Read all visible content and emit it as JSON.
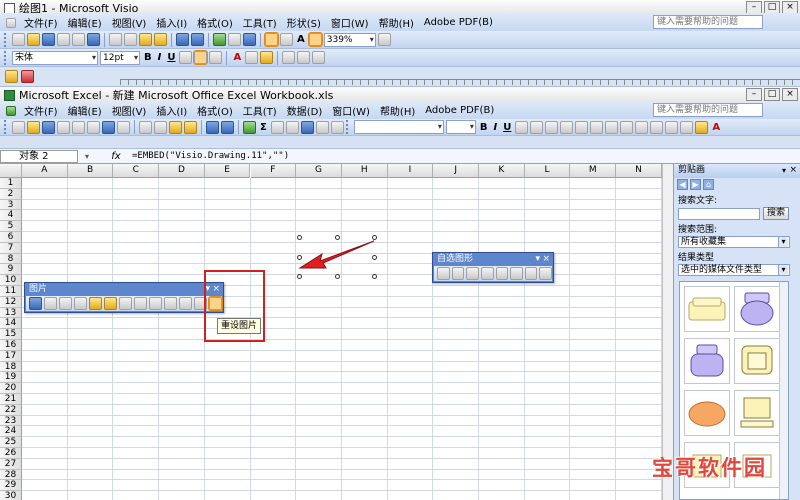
{
  "visio": {
    "title": "绘图1 - Microsoft Visio",
    "menu": [
      "文件(F)",
      "编辑(E)",
      "视图(V)",
      "插入(I)",
      "格式(O)",
      "工具(T)",
      "形状(S)",
      "窗口(W)",
      "帮助(H)",
      "Adobe PDF(B)"
    ],
    "help_placeholder": "键入需要帮助的问题",
    "zoom": "339%",
    "font_name": "宋体",
    "font_size": "12pt"
  },
  "excel": {
    "title": "Microsoft Excel - 新建 Microsoft Office Excel Workbook.xls",
    "menu": [
      "文件(F)",
      "编辑(E)",
      "视图(V)",
      "插入(I)",
      "格式(O)",
      "工具(T)",
      "数据(D)",
      "窗口(W)",
      "帮助(H)",
      "Adobe PDF(B)"
    ],
    "help_placeholder": "键入需要帮助的问题",
    "name_box": "对象 2",
    "fx": "fx",
    "formula": "=EMBED(\"Visio.Drawing.11\",\"\")",
    "columns": [
      "A",
      "B",
      "C",
      "D",
      "E",
      "F",
      "G",
      "H",
      "I",
      "J",
      "K",
      "L",
      "M",
      "N"
    ],
    "rows": [
      "1",
      "2",
      "3",
      "4",
      "5",
      "6",
      "7",
      "8",
      "9",
      "10",
      "11",
      "12",
      "13",
      "14",
      "15",
      "16",
      "17",
      "18",
      "19",
      "20",
      "21",
      "22",
      "23",
      "24",
      "25",
      "26",
      "27",
      "28",
      "29",
      "30"
    ]
  },
  "picture_toolbar": {
    "title": "图片",
    "tooltip": "重设图片"
  },
  "autoshape_toolbar": {
    "title": "自选图形"
  },
  "clipart_pane": {
    "title": "剪贴画",
    "search_label": "搜索文字:",
    "search_button": "搜索",
    "scope_label": "搜索范围:",
    "scope_value": "所有收藏集",
    "types_label": "结果类型",
    "types_value": "选中的媒体文件类型"
  },
  "watermark": "宝哥软件园",
  "colors": {
    "accent_blue": "#5d86cc",
    "highlight_red": "#e02020"
  }
}
